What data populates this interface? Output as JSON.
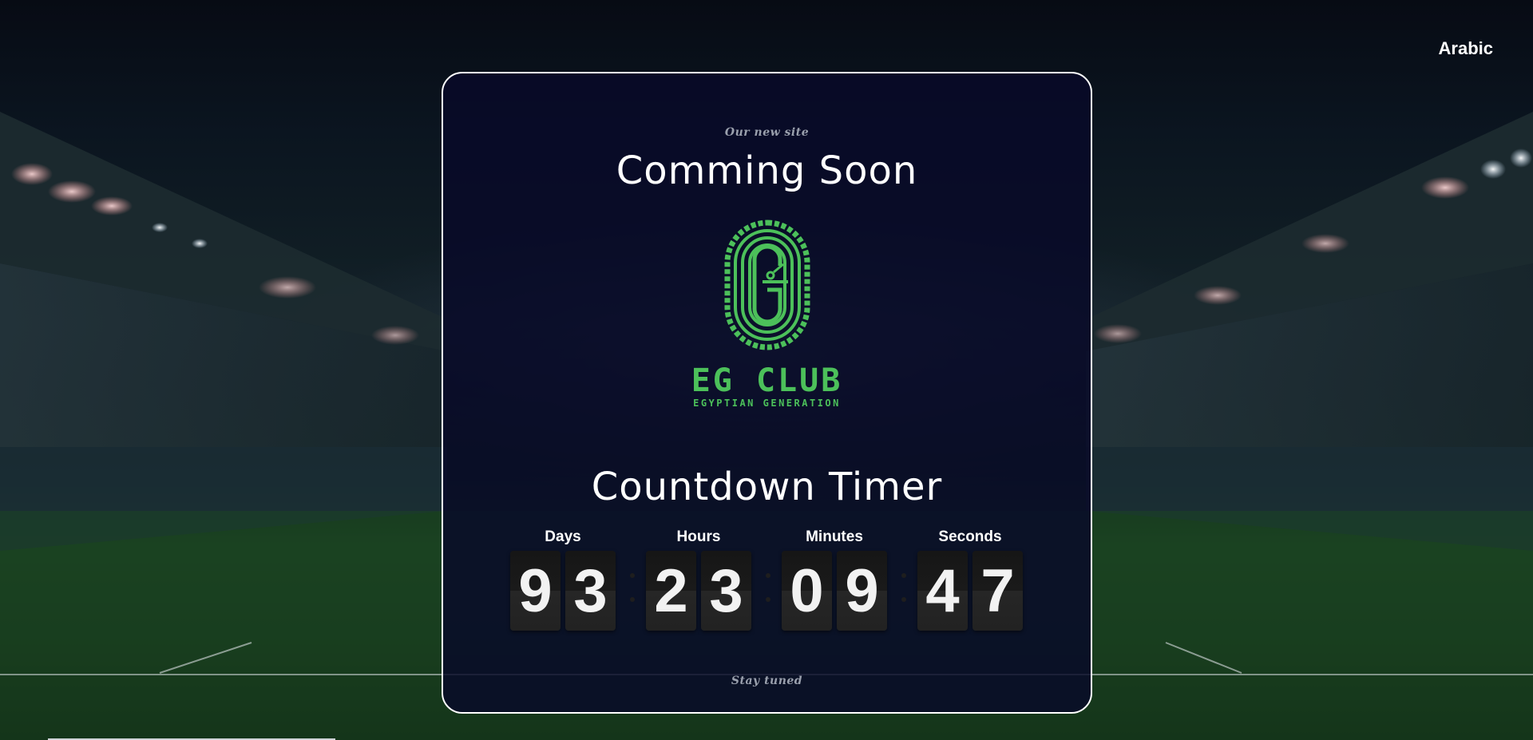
{
  "header": {
    "language_toggle": "Arabic"
  },
  "card": {
    "eyebrow": "Our new site",
    "title": "Comming Soon",
    "logo": {
      "name": "EG CLUB",
      "tagline": "EGYPTIAN GENERATION",
      "color": "#4cc05a"
    },
    "timer_title": "Countdown Timer",
    "countdown": [
      {
        "label": "Days",
        "digits": [
          "9",
          "3"
        ]
      },
      {
        "label": "Hours",
        "digits": [
          "2",
          "3"
        ]
      },
      {
        "label": "Minutes",
        "digits": [
          "0",
          "9"
        ]
      },
      {
        "label": "Seconds",
        "digits": [
          "4",
          "7"
        ]
      }
    ],
    "footer_note": "Stay tuned"
  },
  "colors": {
    "accent": "#4cc05a",
    "card_border": "#ffffff",
    "card_bg": "#080a28"
  }
}
